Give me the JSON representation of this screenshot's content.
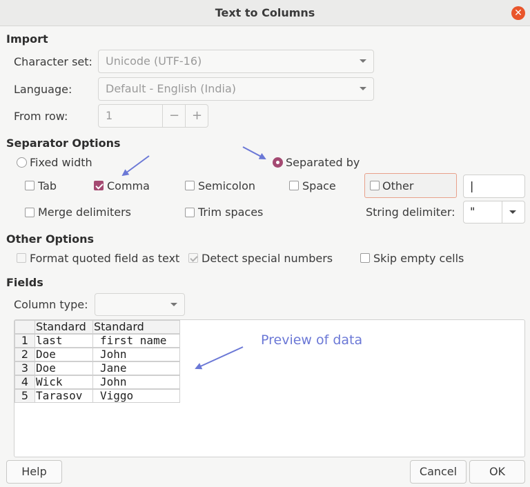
{
  "window": {
    "title": "Text to Columns",
    "close_icon": "close-icon"
  },
  "import": {
    "heading": "Import",
    "charset_label": "Character set:",
    "charset_value": "Unicode (UTF-16)",
    "language_label": "Language:",
    "language_value": "Default - English (India)",
    "from_row_label": "From row:",
    "from_row_value": "1",
    "minus": "−",
    "plus": "+"
  },
  "separator": {
    "heading": "Separator Options",
    "fixed_width": "Fixed width",
    "separated_by": "Separated by",
    "separated_by_selected": true,
    "tab": "Tab",
    "comma": "Comma",
    "comma_checked": true,
    "semicolon": "Semicolon",
    "space": "Space",
    "other": "Other",
    "other_value": "|",
    "merge": "Merge delimiters",
    "trim": "Trim spaces",
    "string_delim_label": "String delimiter:",
    "string_delim_value": "\""
  },
  "other_options": {
    "heading": "Other Options",
    "format_quoted": "Format quoted field as text",
    "detect_special": "Detect special numbers",
    "detect_special_checked": true,
    "skip_empty": "Skip empty cells"
  },
  "fields": {
    "heading": "Fields",
    "column_type_label": "Column type:",
    "column_type_value": ""
  },
  "preview": {
    "columns": [
      "Standard",
      "Standard"
    ],
    "rows": [
      {
        "n": "1",
        "c1": "last",
        "c2": "first name"
      },
      {
        "n": "2",
        "c1": "Doe",
        "c2": "John"
      },
      {
        "n": "3",
        "c1": "Doe",
        "c2": "Jane"
      },
      {
        "n": "4",
        "c1": "Wick",
        "c2": "John"
      },
      {
        "n": "5",
        "c1": "Tarasov",
        "c2": "Viggo"
      }
    ]
  },
  "annotation": {
    "text": "Preview of data",
    "color": "#6b78d6"
  },
  "buttons": {
    "help": "Help",
    "cancel": "Cancel",
    "ok": "OK"
  },
  "colors": {
    "accent": "#a44a72",
    "close": "#e9552b",
    "highlight_border": "#e8a08a"
  }
}
